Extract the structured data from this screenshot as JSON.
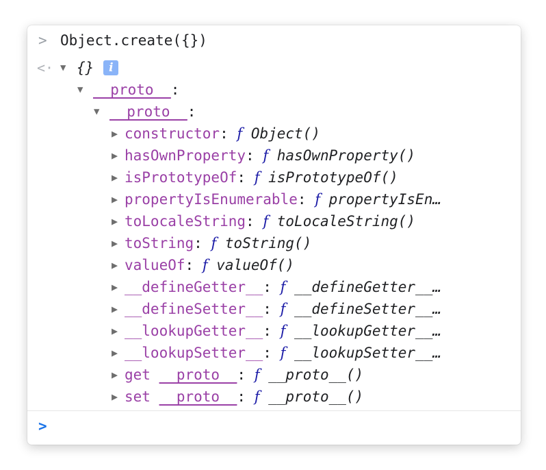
{
  "console": {
    "input_chevron": ">",
    "input": "Object.create({})",
    "result_arrow": "<·",
    "result_label": "{}",
    "info_glyph": "i",
    "proto1_key": "__proto__",
    "proto2_key": "__proto__",
    "colon": ":",
    "fn_glyph": "f",
    "properties": [
      {
        "key": "constructor",
        "value": "Object()"
      },
      {
        "key": "hasOwnProperty",
        "value": "hasOwnProperty()"
      },
      {
        "key": "isPrototypeOf",
        "value": "isPrototypeOf()"
      },
      {
        "key": "propertyIsEnumerable",
        "value": "propertyIsEn…"
      },
      {
        "key": "toLocaleString",
        "value": "toLocaleString()"
      },
      {
        "key": "toString",
        "value": "toString()"
      },
      {
        "key": "valueOf",
        "value": "valueOf()"
      },
      {
        "key": "__defineGetter__",
        "value": "__defineGetter__…"
      },
      {
        "key": "__defineSetter__",
        "value": "__defineSetter__…"
      },
      {
        "key": "__lookupGetter__",
        "value": "__lookupGetter__…"
      },
      {
        "key": "__lookupSetter__",
        "value": "__lookupSetter__…"
      },
      {
        "key": "get __proto__",
        "value": "__proto__()"
      },
      {
        "key": "set __proto__",
        "value": "__proto__()"
      }
    ],
    "prompt_chevron": ">"
  },
  "colors": {
    "key": "#9a40a6",
    "function_glyph": "#1a1aa6",
    "prompt": "#1a73e8",
    "info_badge": "#8ab4f8"
  },
  "icons": {
    "collapse": "triangle-down-icon",
    "expand": "triangle-right-icon",
    "result": "result-arrow-icon",
    "info": "info-icon"
  }
}
